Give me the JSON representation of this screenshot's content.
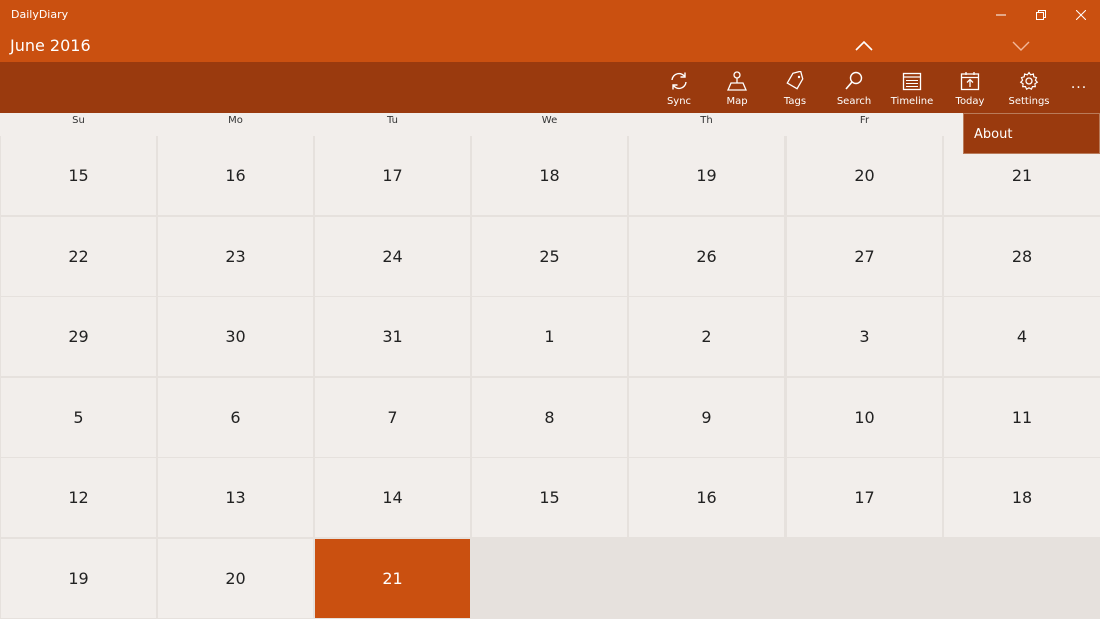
{
  "app": {
    "title": "DailyDiary"
  },
  "header": {
    "month_title": "June 2016"
  },
  "commands": [
    {
      "label": "Sync",
      "icon": "sync-icon"
    },
    {
      "label": "Map",
      "icon": "map-icon"
    },
    {
      "label": "Tags",
      "icon": "tag-icon"
    },
    {
      "label": "Search",
      "icon": "search-icon"
    },
    {
      "label": "Timeline",
      "icon": "timeline-icon"
    },
    {
      "label": "Today",
      "icon": "calendar-today-icon"
    },
    {
      "label": "Settings",
      "icon": "gear-icon"
    }
  ],
  "more_label": "···",
  "menu": {
    "about_label": "About"
  },
  "day_names": [
    "Su",
    "Mo",
    "Tu",
    "We",
    "Th",
    "Fr"
  ],
  "weeks": [
    [
      "15",
      "16",
      "17",
      "18",
      "19",
      "20",
      "21"
    ],
    [
      "22",
      "23",
      "24",
      "25",
      "26",
      "27",
      "28"
    ],
    [
      "29",
      "30",
      "31",
      "1",
      "2",
      "3",
      "4"
    ],
    [
      "5",
      "6",
      "7",
      "8",
      "9",
      "10",
      "11"
    ],
    [
      "12",
      "13",
      "14",
      "15",
      "16",
      "17",
      "18"
    ],
    [
      "19",
      "20",
      "21"
    ]
  ],
  "today": {
    "week": 5,
    "day": 2
  },
  "colors": {
    "accent": "#ca5010",
    "command_bar": "#9a3a0e",
    "cell": "#f2eeeb",
    "empty": "#e6e1dd"
  }
}
